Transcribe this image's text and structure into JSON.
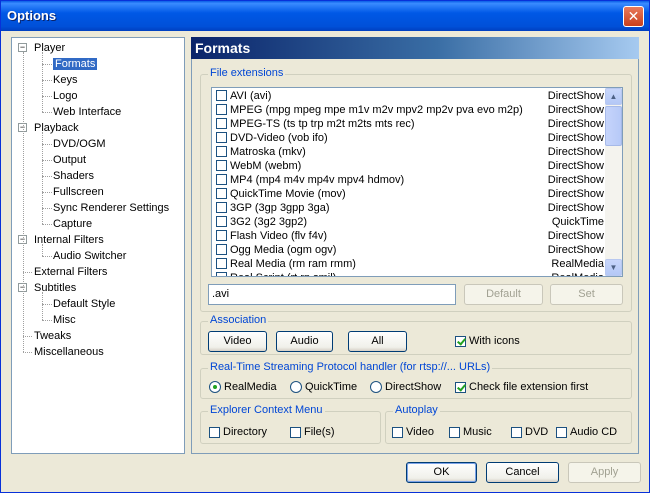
{
  "window": {
    "title": "Options",
    "close_symbol": "✕"
  },
  "tree": {
    "items": [
      {
        "label": "Player",
        "level": 0,
        "expander": "−"
      },
      {
        "label": "Formats",
        "level": 1,
        "selected": true
      },
      {
        "label": "Keys",
        "level": 1
      },
      {
        "label": "Logo",
        "level": 1
      },
      {
        "label": "Web Interface",
        "level": 1
      },
      {
        "label": "Playback",
        "level": 0,
        "expander": "−"
      },
      {
        "label": "DVD/OGM",
        "level": 1
      },
      {
        "label": "Output",
        "level": 1
      },
      {
        "label": "Shaders",
        "level": 1
      },
      {
        "label": "Fullscreen",
        "level": 1
      },
      {
        "label": "Sync Renderer Settings",
        "level": 1
      },
      {
        "label": "Capture",
        "level": 1
      },
      {
        "label": "Internal Filters",
        "level": 0,
        "expander": "−"
      },
      {
        "label": "Audio Switcher",
        "level": 1
      },
      {
        "label": "External Filters",
        "level": 0
      },
      {
        "label": "Subtitles",
        "level": 0,
        "expander": "−"
      },
      {
        "label": "Default Style",
        "level": 1
      },
      {
        "label": "Misc",
        "level": 1
      },
      {
        "label": "Tweaks",
        "level": 0
      },
      {
        "label": "Miscellaneous",
        "level": 0
      }
    ]
  },
  "panel": {
    "title": "Formats"
  },
  "file_extensions": {
    "label": "File extensions",
    "rows": [
      {
        "name": "AVI (avi)",
        "filter": "DirectShow"
      },
      {
        "name": "MPEG (mpg mpeg mpe m1v m2v mpv2 mp2v pva evo m2p)",
        "filter": "DirectShow"
      },
      {
        "name": "MPEG-TS (ts tp trp m2t m2ts mts rec)",
        "filter": "DirectShow"
      },
      {
        "name": "DVD-Video (vob ifo)",
        "filter": "DirectShow"
      },
      {
        "name": "Matroska (mkv)",
        "filter": "DirectShow"
      },
      {
        "name": "WebM (webm)",
        "filter": "DirectShow"
      },
      {
        "name": "MP4 (mp4 m4v mp4v mpv4 hdmov)",
        "filter": "DirectShow"
      },
      {
        "name": "QuickTime Movie (mov)",
        "filter": "DirectShow"
      },
      {
        "name": "3GP (3gp 3gpp 3ga)",
        "filter": "DirectShow"
      },
      {
        "name": "3G2 (3g2 3gp2)",
        "filter": "QuickTime"
      },
      {
        "name": "Flash Video (flv f4v)",
        "filter": "DirectShow"
      },
      {
        "name": "Ogg Media (ogm ogv)",
        "filter": "DirectShow"
      },
      {
        "name": "Real Media (rm ram rmm)",
        "filter": "RealMedia"
      },
      {
        "name": "Real Script (rt rp smil)",
        "filter": "RealMedia"
      }
    ],
    "ext_value": ".avi",
    "default_label": "Default",
    "set_label": "Set"
  },
  "association": {
    "label": "Association",
    "video_label": "Video",
    "audio_label": "Audio",
    "all_label": "All",
    "with_icons_label": "With icons",
    "with_icons_checked": true
  },
  "rtsp": {
    "label": "Real-Time Streaming Protocol handler (for rtsp://... URLs)",
    "options": [
      "RealMedia",
      "QuickTime",
      "DirectShow"
    ],
    "selected": "RealMedia",
    "check_ext_label": "Check file extension first",
    "check_ext_checked": true
  },
  "context_menu": {
    "label": "Explorer Context Menu",
    "directory_label": "Directory",
    "files_label": "File(s)"
  },
  "autoplay": {
    "label": "Autoplay",
    "video_label": "Video",
    "music_label": "Music",
    "dvd_label": "DVD",
    "audiocd_label": "Audio CD"
  },
  "footer": {
    "ok_label": "OK",
    "cancel_label": "Cancel",
    "apply_label": "Apply"
  }
}
